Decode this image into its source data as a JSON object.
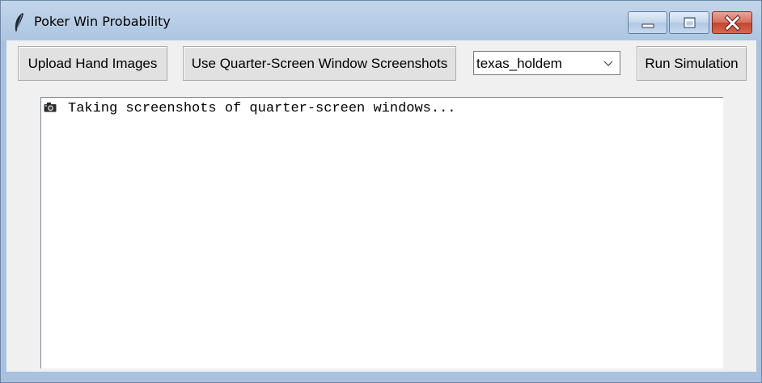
{
  "window": {
    "title": "Poker Win Probability"
  },
  "toolbar": {
    "upload_label": "Upload Hand Images",
    "quarter_screen_label": "Use Quarter-Screen Window Screenshots",
    "game_select_value": "texas_holdem",
    "run_label": "Run Simulation"
  },
  "log": {
    "icon": "camera-icon",
    "line": "Taking screenshots of quarter-screen windows..."
  },
  "colors": {
    "titlebar": "#b6cde6",
    "close_button": "#c44530",
    "client_background": "#f0f0f0"
  }
}
